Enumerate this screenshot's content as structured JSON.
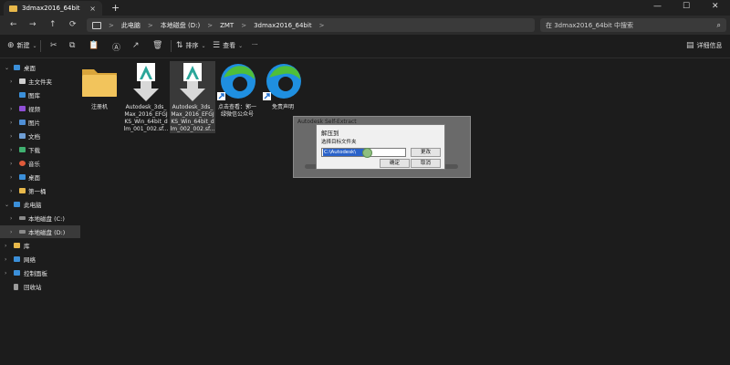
{
  "window": {
    "tab_title": "3dmax2016_64bit",
    "tab_close": "×",
    "new_tab": "+",
    "minimize": "—",
    "maximize": "☐",
    "close": "✕"
  },
  "nav": {
    "back": "←",
    "forward": "→",
    "up": "↑",
    "refresh": "⟳",
    "breadcrumbs": [
      "此电脑",
      "本地磁盘 (D:)",
      "ZMT",
      "3dmax2016_64bit"
    ],
    "separator": ">",
    "search_placeholder": "在 3dmax2016_64bit 中搜索",
    "search_icon": "search-icon"
  },
  "toolbar": {
    "new_label": "新建",
    "sort_label": "排序",
    "view_label": "查看",
    "more": "···",
    "details_label": "详细信息"
  },
  "sidebar": {
    "items": [
      {
        "label": "桌面",
        "icon": "desktop-icon",
        "color": "#3b8fd9"
      },
      {
        "label": "主文件夹",
        "icon": "home-icon",
        "color": "#cfcfcf"
      },
      {
        "label": "图库",
        "icon": "gallery-icon",
        "color": "#3b8fd9"
      },
      {
        "label": "视频",
        "icon": "video-icon",
        "color": "#8f4fd6"
      },
      {
        "label": "图片",
        "icon": "picture-icon",
        "color": "#4f8fd6"
      },
      {
        "label": "文档",
        "icon": "document-icon",
        "color": "#6f9fd6"
      },
      {
        "label": "下载",
        "icon": "download-icon",
        "color": "#3fb070"
      },
      {
        "label": "音乐",
        "icon": "music-icon",
        "color": "#e05a3a"
      },
      {
        "label": "桌面",
        "icon": "desktop-icon",
        "color": "#3b8fd9"
      },
      {
        "label": "第一桶",
        "icon": "folder-icon",
        "color": "#e8b84a"
      },
      {
        "label": "此电脑",
        "icon": "computer-icon",
        "color": "#3b8fd9"
      },
      {
        "label": "本地磁盘 (C:)",
        "icon": "drive-icon",
        "color": "#8a8a8a"
      },
      {
        "label": "本地磁盘 (D:)",
        "icon": "drive-icon",
        "color": "#8a8a8a"
      },
      {
        "label": "库",
        "icon": "library-icon",
        "color": "#e8b84a"
      },
      {
        "label": "网络",
        "icon": "network-icon",
        "color": "#3b8fd9"
      },
      {
        "label": "控制面板",
        "icon": "control-panel-icon",
        "color": "#3b8fd9"
      },
      {
        "label": "回收站",
        "icon": "recycle-bin-icon",
        "color": "#9a9a9a"
      }
    ]
  },
  "files": [
    {
      "name": "注册机",
      "icon": "folder-icon"
    },
    {
      "name": "Autodesk_3ds_Max_2016_EFGJKS_Win_64bit_dlm_001_002.sfx.exe",
      "display": "Autodesk_3ds_\nMax_2016_EFGJ\nKS_Win_64bit_d\nlm_001_002.sf...",
      "icon": "autodesk-installer-icon"
    },
    {
      "name": "Autodesk_3ds_Max_2016_EFGJKS_Win_64bit_dlm_002_002.sfx.exe",
      "display": "Autodesk_3ds_\nMax_2016_EFGJ\nKS_Win_64bit_d\nlm_002_002.sf...",
      "icon": "autodesk-installer-icon"
    },
    {
      "name": "点击查看：郭一绿微信公众号",
      "display": "点击查看：郭一\n绿微信公众号",
      "icon": "edge-shortcut-icon"
    },
    {
      "name": "免责声明",
      "icon": "edge-shortcut-icon"
    }
  ],
  "extract_window": {
    "title": "Autodesk Self-Extract"
  },
  "dialog": {
    "title": "解压到",
    "subtitle": "选择目标文件夹",
    "path_value": "C:\\Autodesk\\",
    "change_button": "更改",
    "ok_button": "确定",
    "cancel_button": "取消"
  },
  "colors": {
    "accent": "#2a62c9",
    "folder": "#e8b84a",
    "edge_blue": "#1f8fe0",
    "edge_green": "#4fbf3a",
    "autodesk_teal": "#2aa69a"
  }
}
